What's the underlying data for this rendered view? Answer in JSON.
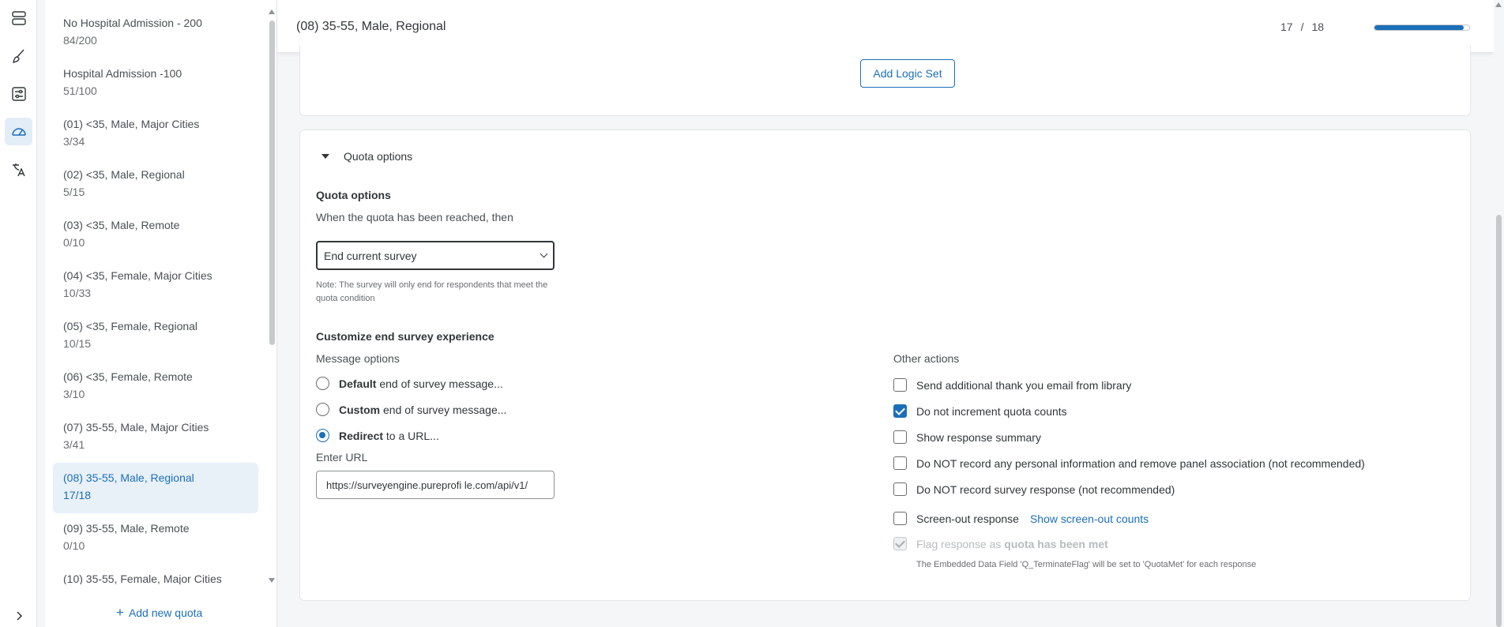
{
  "rail": {
    "items": [
      {
        "icon": "survey-icon"
      },
      {
        "icon": "brush-icon"
      },
      {
        "icon": "survey-options-icon"
      },
      {
        "icon": "quotas-gauge-icon"
      },
      {
        "icon": "translate-icon"
      }
    ],
    "expand_icon": "chevron-right-icon"
  },
  "quotas": {
    "items": [
      {
        "name": "No Hospital Admission - 200",
        "count": "84/200"
      },
      {
        "name": "Hospital Admission -100",
        "count": "51/100"
      },
      {
        "name": "(01) <35, Male, Major Cities",
        "count": "3/34"
      },
      {
        "name": "(02) <35, Male, Regional",
        "count": "5/15"
      },
      {
        "name": "(03) <35, Male, Remote",
        "count": "0/10"
      },
      {
        "name": "(04) <35, Female, Major Cities",
        "count": "10/33"
      },
      {
        "name": "(05) <35, Female, Regional",
        "count": "10/15"
      },
      {
        "name": "(06) <35, Female, Remote",
        "count": "3/10"
      },
      {
        "name": "(07) 35-55, Male, Major Cities",
        "count": "3/41"
      },
      {
        "name": "(08) 35-55, Male, Regional",
        "count": "17/18"
      },
      {
        "name": "(09) 35-55, Male, Remote",
        "count": "0/10"
      },
      {
        "name": "(10) 35-55, Female, Major Cities",
        "count": ""
      }
    ],
    "selected_index": 9,
    "add_label": "Add new quota"
  },
  "header": {
    "title": "(08) 35-55, Male, Regional",
    "current": "17",
    "separator": "/",
    "total": "18",
    "progress": 0.944
  },
  "logic": {
    "add_logic_set": "Add Logic Set"
  },
  "options": {
    "section_toggle": "Quota options",
    "heading": "Quota options",
    "when_label": "When the quota has been reached, then",
    "action_value": "End current survey",
    "note": "Note: The survey will only end for respondents that meet the quota condition",
    "customize_heading": "Customize end survey experience",
    "message_options_label": "Message options",
    "radios": [
      {
        "bold": "Default",
        "rest": " end of survey message...",
        "checked": false
      },
      {
        "bold": "Custom",
        "rest": " end of survey message...",
        "checked": false
      },
      {
        "bold": "Redirect",
        "rest": " to a URL...",
        "checked": true
      }
    ],
    "url_label": "Enter URL",
    "url_value": "https://surveyengine.pureprofi le.com/api/v1/",
    "other_actions_label": "Other actions",
    "checks": [
      {
        "label": "Send additional thank you email from library",
        "checked": false
      },
      {
        "label": "Do not increment quota counts",
        "checked": true
      },
      {
        "label": "Show response summary",
        "checked": false
      },
      {
        "label": "Do NOT record any personal information and remove panel association (not recommended)",
        "checked": false
      },
      {
        "label": "Do NOT record survey response (not recommended)",
        "checked": false
      }
    ],
    "screen_out_label": "Screen-out response",
    "screen_out_link": "Show screen-out counts",
    "flag_prefix": "Flag response as",
    "flag_bold": "quota has been met",
    "flag_note": "The Embedded Data Field 'Q_TerminateFlag' will be set to 'QuotaMet' for each response"
  },
  "colors": {
    "accent": "#1b6fb8",
    "selected_bg": "#e8f0f8"
  }
}
